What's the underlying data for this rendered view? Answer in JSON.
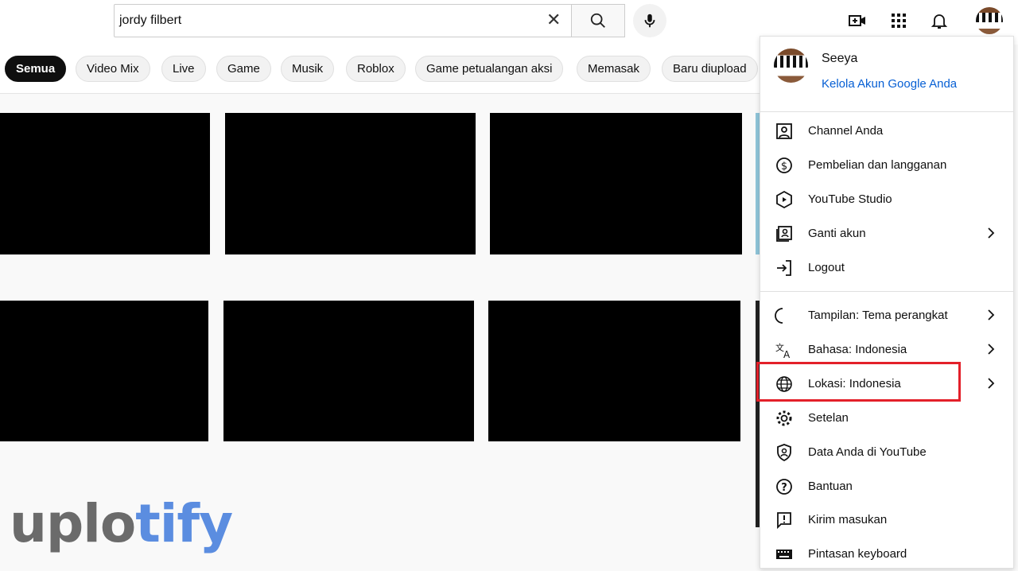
{
  "search": {
    "value": "jordy filbert"
  },
  "chips": [
    "Semua",
    "Video Mix",
    "Live",
    "Game",
    "Musik",
    "Roblox",
    "Game petualangan aksi",
    "Memasak",
    "Baru diupload"
  ],
  "account": {
    "name": "Seeya",
    "manage_link": "Kelola Akun Google Anda"
  },
  "menu": {
    "items": [
      {
        "label": "Channel Anda",
        "icon": "person-box-icon",
        "chevron": false
      },
      {
        "label": "Pembelian dan langganan",
        "icon": "dollar-icon",
        "chevron": false
      },
      {
        "label": "YouTube Studio",
        "icon": "studio-icon",
        "chevron": false
      },
      {
        "label": "Ganti akun",
        "icon": "switch-account-icon",
        "chevron": true
      },
      {
        "label": "Logout",
        "icon": "logout-icon",
        "chevron": false
      },
      {
        "label": "Tampilan: Tema perangkat",
        "icon": "moon-icon",
        "chevron": true
      },
      {
        "label": "Bahasa: Indonesia",
        "icon": "translate-icon",
        "chevron": true
      },
      {
        "label": "Lokasi: Indonesia",
        "icon": "globe-icon",
        "chevron": true
      },
      {
        "label": "Setelan",
        "icon": "gear-icon",
        "chevron": false
      },
      {
        "label": "Data Anda di YouTube",
        "icon": "shield-person-icon",
        "chevron": false
      },
      {
        "label": "Bantuan",
        "icon": "help-icon",
        "chevron": false
      },
      {
        "label": "Kirim masukan",
        "icon": "feedback-icon",
        "chevron": false
      },
      {
        "label": "Pintasan keyboard",
        "icon": "keyboard-icon",
        "chevron": false
      }
    ],
    "highlighted": "Lokasi: Indonesia",
    "highlight_color": "#e3202a"
  },
  "watermark": {
    "part1": "uplo",
    "part2": "tify",
    "color1": "#6b6b6b",
    "color2": "#5b8de0"
  },
  "colors": {
    "link": "#065fd4"
  }
}
